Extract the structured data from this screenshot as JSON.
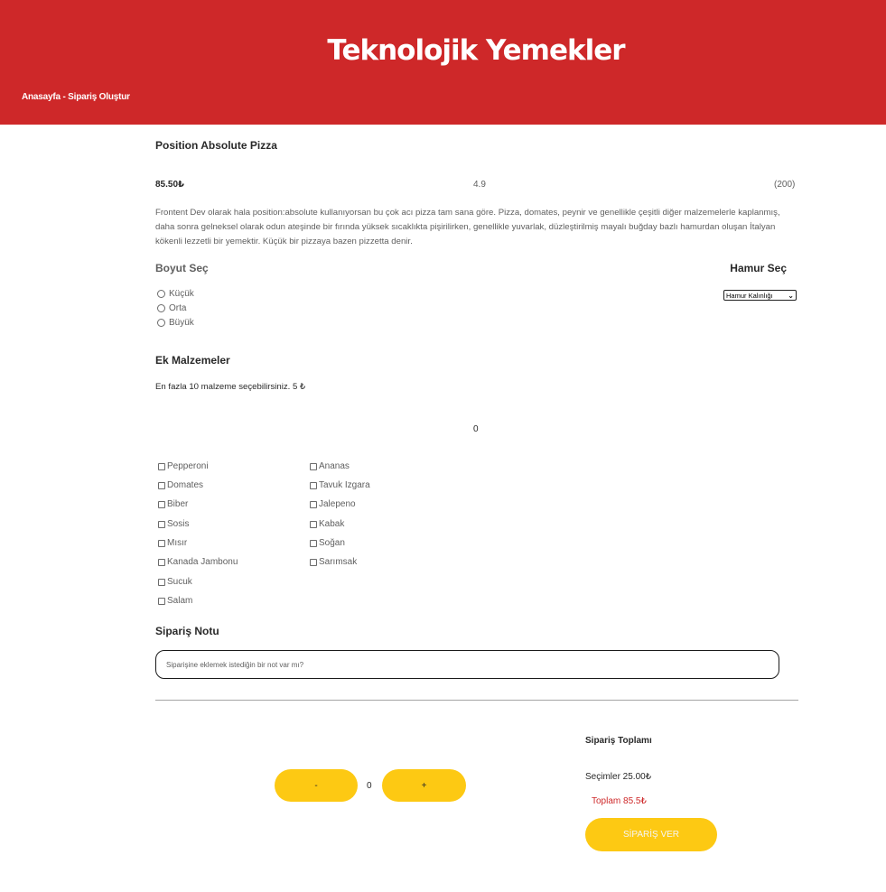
{
  "header": {
    "brand": "Teknolojik Yemekler",
    "breadcrumb": "Anasayfa - Sipariş Oluştur"
  },
  "product": {
    "name": "Position Absolute Pizza",
    "price": "85.50₺",
    "rating": "4.9",
    "review_count": "(200)",
    "description": "Frontent Dev olarak hala position:absolute kullanıyorsan bu çok acı pizza tam sana göre. Pizza, domates, peynir ve genellikle çeşitli diğer malzemelerle kaplanmış, daha sonra gelneksel olarak odun ateşinde bir fırında yüksek sıcaklıkta pişirilirken, genellikle yuvarlak, düzleştirilmiş mayalı buğday bazlı hamurdan oluşan İtalyan kökenli lezzetli bir yemektir. Küçük bir pizzaya bazen pizzetta denir."
  },
  "size": {
    "title": "Boyut Seç",
    "options": [
      "Küçük",
      "Orta",
      "Büyük"
    ]
  },
  "dough": {
    "title": "Hamur Seç",
    "selected": "Hamur Kalınlığı"
  },
  "extras": {
    "title": "Ek Malzemeler",
    "note": "En fazla 10 malzeme seçebilirsiniz. 5 ₺",
    "selected_count": "0",
    "column1": [
      "Pepperoni",
      "Domates",
      "Biber",
      "Sosis",
      "Mısır",
      "Kanada Jambonu",
      "Sucuk",
      "Salam"
    ],
    "column2": [
      "Ananas",
      "Tavuk Izgara",
      "Jalepeno",
      "Kabak",
      "Soğan",
      "Sarımsak"
    ]
  },
  "order_note": {
    "title": "Sipariş Notu",
    "placeholder": "Siparişine eklemek istediğin bir not var mı?"
  },
  "quantity": {
    "minus": "-",
    "value": "0",
    "plus": "+"
  },
  "summary": {
    "title": "Sipariş Toplamı",
    "selections": "Seçimler 25.00₺",
    "total": "Toplam 85.5₺",
    "button": "SİPARİŞ VER"
  },
  "colors": {
    "brand_red": "#ce2829",
    "accent_yellow": "#fdc913"
  }
}
